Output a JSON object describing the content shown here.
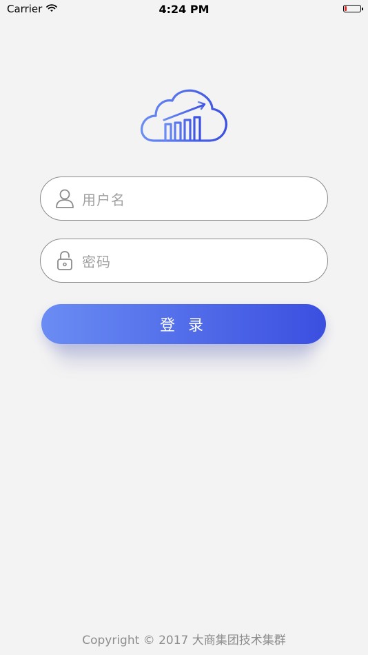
{
  "status_bar": {
    "carrier": "Carrier",
    "time": "4:24 PM",
    "battery_level": 0.12,
    "battery_color": "#e0302a"
  },
  "logo": {
    "icon": "cloud-chart-icon",
    "gradient": [
      "#6a8cf3",
      "#3b4fe0"
    ]
  },
  "form": {
    "username_placeholder": "用户名",
    "password_placeholder": "密码",
    "login_label": "登 录"
  },
  "footer": {
    "copyright": "Copyright © 2017 大商集团技术集群"
  },
  "colors": {
    "background": "#f3f3f3",
    "accent_start": "#6a8cf3",
    "accent_end": "#3b4fe0"
  }
}
